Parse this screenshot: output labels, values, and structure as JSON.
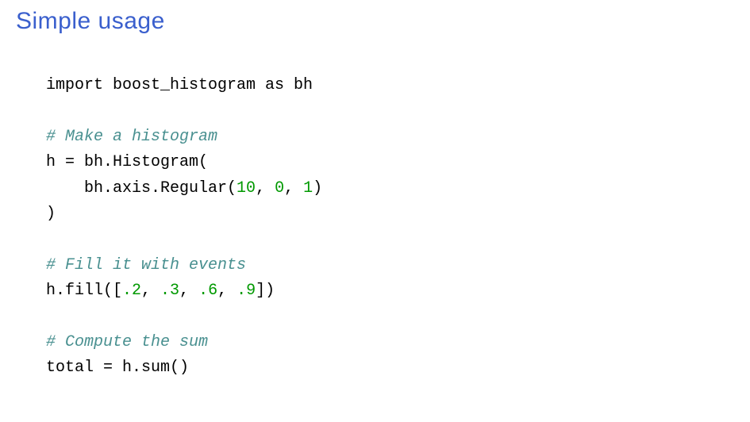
{
  "title": "Simple usage",
  "code": {
    "l1": "import boost_histogram as bh",
    "l2": "",
    "c1": "# Make a histogram",
    "l3a": "h = bh.Histogram(",
    "l4a": "    bh.axis.Regular(",
    "n10": "10",
    "sep1": ", ",
    "n0": "0",
    "sep2": ", ",
    "n1": "1",
    "l4b": ")",
    "l5": ")",
    "l6": "",
    "c2": "# Fill it with events",
    "l7a": "h.fill([",
    "v1": ".2",
    "sep3": ", ",
    "v2": ".3",
    "sep4": ", ",
    "v3": ".6",
    "sep5": ", ",
    "v4": ".9",
    "l7b": "])",
    "l8": "",
    "c3": "# Compute the sum",
    "l9": "total = h.sum()"
  }
}
